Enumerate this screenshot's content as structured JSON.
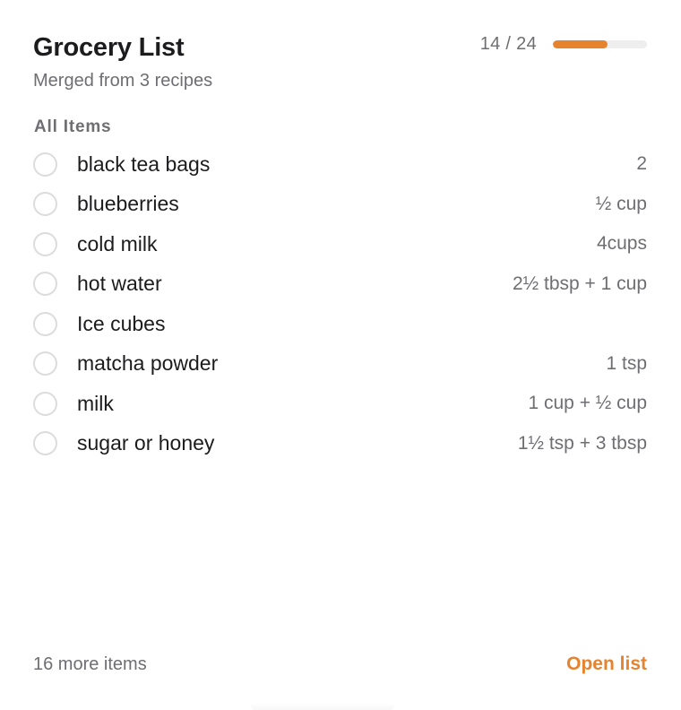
{
  "header": {
    "title": "Grocery List",
    "subtitle": "Merged from 3 recipes",
    "progress_text": "14 / 24",
    "progress_fraction": 0.583,
    "accent_color": "#e5832f"
  },
  "section": {
    "title": "All Items"
  },
  "items": [
    {
      "name": "black tea bags",
      "qty": "2",
      "checked": false
    },
    {
      "name": "blueberries",
      "qty": "½ cup",
      "checked": false
    },
    {
      "name": "cold milk",
      "qty": "4cups",
      "checked": false
    },
    {
      "name": "hot water",
      "qty": "2½ tbsp + 1 cup",
      "checked": false
    },
    {
      "name": "Ice cubes",
      "qty": "",
      "checked": false
    },
    {
      "name": "matcha powder",
      "qty": "1 tsp",
      "checked": false
    },
    {
      "name": "milk",
      "qty": "1 cup + ½ cup",
      "checked": false
    },
    {
      "name": "sugar or honey",
      "qty": "1½ tsp + 3 tbsp",
      "checked": false
    }
  ],
  "footer": {
    "more_items": "16 more items",
    "open_list": "Open list"
  }
}
